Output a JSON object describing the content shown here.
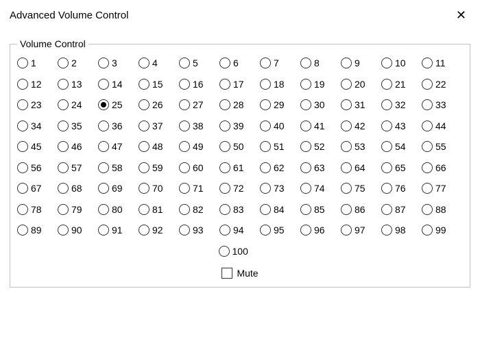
{
  "window": {
    "title": "Advanced Volume Control"
  },
  "group": {
    "legend": "Volume Control"
  },
  "volume": {
    "selected": 25,
    "levels": [
      1,
      2,
      3,
      4,
      5,
      6,
      7,
      8,
      9,
      10,
      11,
      12,
      13,
      14,
      15,
      16,
      17,
      18,
      19,
      20,
      21,
      22,
      23,
      24,
      25,
      26,
      27,
      28,
      29,
      30,
      31,
      32,
      33,
      34,
      35,
      36,
      37,
      38,
      39,
      40,
      41,
      42,
      43,
      44,
      45,
      46,
      47,
      48,
      49,
      50,
      51,
      52,
      53,
      54,
      55,
      56,
      57,
      58,
      59,
      60,
      61,
      62,
      63,
      64,
      65,
      66,
      67,
      68,
      69,
      70,
      71,
      72,
      73,
      74,
      75,
      76,
      77,
      78,
      79,
      80,
      81,
      82,
      83,
      84,
      85,
      86,
      87,
      88,
      89,
      90,
      91,
      92,
      93,
      94,
      95,
      96,
      97,
      98,
      99,
      100
    ]
  },
  "mute": {
    "label": "Mute",
    "checked": false
  }
}
